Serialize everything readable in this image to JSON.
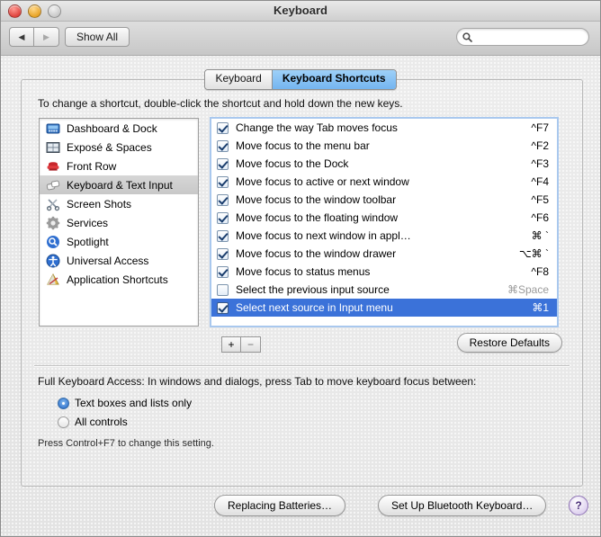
{
  "window": {
    "title": "Keyboard",
    "traffic": {
      "close": "close-button",
      "minimize": "minimize-button",
      "zoom": "zoom-button"
    }
  },
  "toolbar": {
    "back_label": "◀",
    "forward_label": "▶",
    "show_all_label": "Show All",
    "search_value": "",
    "search_placeholder": ""
  },
  "tabs": [
    {
      "label": "Keyboard",
      "active": false
    },
    {
      "label": "Keyboard Shortcuts",
      "active": true
    }
  ],
  "main": {
    "hint": "To change a shortcut, double-click the shortcut and hold down the new keys.",
    "categories": [
      {
        "label": "Dashboard & Dock",
        "icon": "dashboard-icon",
        "selected": false
      },
      {
        "label": "Exposé & Spaces",
        "icon": "expose-grid-icon",
        "selected": false
      },
      {
        "label": "Front Row",
        "icon": "front-row-chair-icon",
        "selected": false
      },
      {
        "label": "Keyboard & Text Input",
        "icon": "keyboard-keys-icon",
        "selected": true
      },
      {
        "label": "Screen Shots",
        "icon": "scissors-icon",
        "selected": false
      },
      {
        "label": "Services",
        "icon": "gear-icon",
        "selected": false
      },
      {
        "label": "Spotlight",
        "icon": "spotlight-magnifier-icon",
        "selected": false
      },
      {
        "label": "Universal Access",
        "icon": "universal-access-icon",
        "selected": false
      },
      {
        "label": "Application Shortcuts",
        "icon": "application-icon",
        "selected": false
      }
    ],
    "shortcuts": [
      {
        "label": "Change the way Tab moves focus",
        "key": "^F7",
        "checked": true,
        "selected": false,
        "dimmed": false
      },
      {
        "label": "Move focus to the menu bar",
        "key": "^F2",
        "checked": true,
        "selected": false,
        "dimmed": false
      },
      {
        "label": "Move focus to the Dock",
        "key": "^F3",
        "checked": true,
        "selected": false,
        "dimmed": false
      },
      {
        "label": "Move focus to active or next window",
        "key": "^F4",
        "checked": true,
        "selected": false,
        "dimmed": false
      },
      {
        "label": "Move focus to the window toolbar",
        "key": "^F5",
        "checked": true,
        "selected": false,
        "dimmed": false
      },
      {
        "label": "Move focus to the floating window",
        "key": "^F6",
        "checked": true,
        "selected": false,
        "dimmed": false
      },
      {
        "label": "Move focus to next window in appl…",
        "key": "⌘ `",
        "checked": true,
        "selected": false,
        "dimmed": false
      },
      {
        "label": "Move focus to the window drawer",
        "key": "⌥⌘ `",
        "checked": true,
        "selected": false,
        "dimmed": false
      },
      {
        "label": "Move focus to status menus",
        "key": "^F8",
        "checked": true,
        "selected": false,
        "dimmed": false
      },
      {
        "label": "Select the previous input source",
        "key": "⌘Space",
        "checked": false,
        "selected": false,
        "dimmed": true
      },
      {
        "label": "Select next source in Input menu",
        "key": "⌘1",
        "checked": true,
        "selected": true,
        "dimmed": false
      }
    ],
    "add_label": "+",
    "remove_label": "−",
    "restore_defaults_label": "Restore Defaults",
    "full_keyboard_access_label": "Full Keyboard Access: In windows and dialogs, press Tab to move keyboard focus between:",
    "radios": [
      {
        "label": "Text boxes and lists only",
        "selected": true
      },
      {
        "label": "All controls",
        "selected": false
      }
    ],
    "note": "Press Control+F7 to change this setting."
  },
  "bottom": {
    "replacing_batteries_label": "Replacing Batteries…",
    "bluetooth_label": "Set Up Bluetooth Keyboard…",
    "help_label": "?"
  },
  "colors": {
    "selection_blue": "#3b72d9",
    "tab_active": "#74b5f0",
    "window_bg": "#e6e6e6"
  }
}
